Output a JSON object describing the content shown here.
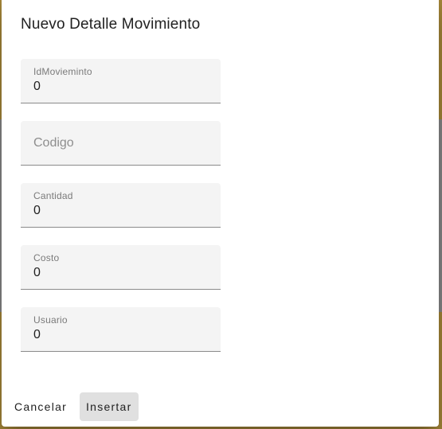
{
  "dialog": {
    "title": "Nuevo Detalle Movimiento"
  },
  "form": {
    "fields": [
      {
        "label": "IdMovieminto",
        "value": "0"
      },
      {
        "placeholder": "Codigo",
        "value": ""
      },
      {
        "label": "Cantidad",
        "value": "0"
      },
      {
        "label": "Costo",
        "value": "0"
      },
      {
        "label": "Usuario",
        "value": "0"
      }
    ]
  },
  "actions": {
    "cancel_label": "Cancelar",
    "submit_label": "Insertar"
  },
  "colors": {
    "backdrop_gold": "#a8893a",
    "field_background": "#f4f4f4",
    "primary_button": "#e0e0e0"
  }
}
